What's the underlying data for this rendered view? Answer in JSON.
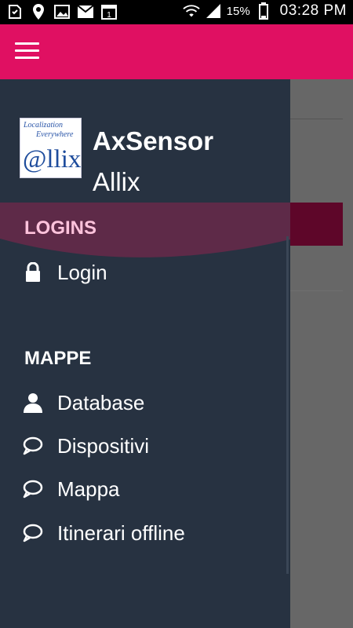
{
  "status_bar": {
    "icons": [
      "sd-card-icon",
      "location-pin-icon",
      "image-icon",
      "mail-icon",
      "calendar-icon"
    ],
    "calendar_day": "1",
    "battery_percent": "15%",
    "time": "03:28 PM"
  },
  "app": {
    "menu_icon": "hamburger-icon",
    "accent": "#e01062"
  },
  "drawer": {
    "logo": {
      "line1": "Localization",
      "line2": "Everywhere",
      "mark": "@llix"
    },
    "title": "AxSensor",
    "subtitle": "Allix",
    "sections": [
      {
        "label": "LOGINS",
        "items": [
          {
            "label": "Login",
            "icon": "lock-icon"
          }
        ]
      },
      {
        "label": "MAPPE",
        "items": [
          {
            "label": "Database",
            "icon": "person-icon"
          },
          {
            "label": "Dispositivi",
            "icon": "chat-bubble-icon"
          },
          {
            "label": "Mappa",
            "icon": "chat-bubble-icon"
          },
          {
            "label": "Itinerari offline",
            "icon": "chat-bubble-icon"
          }
        ]
      }
    ],
    "background": "#273241",
    "highlight_color": "#ffc3dc"
  }
}
